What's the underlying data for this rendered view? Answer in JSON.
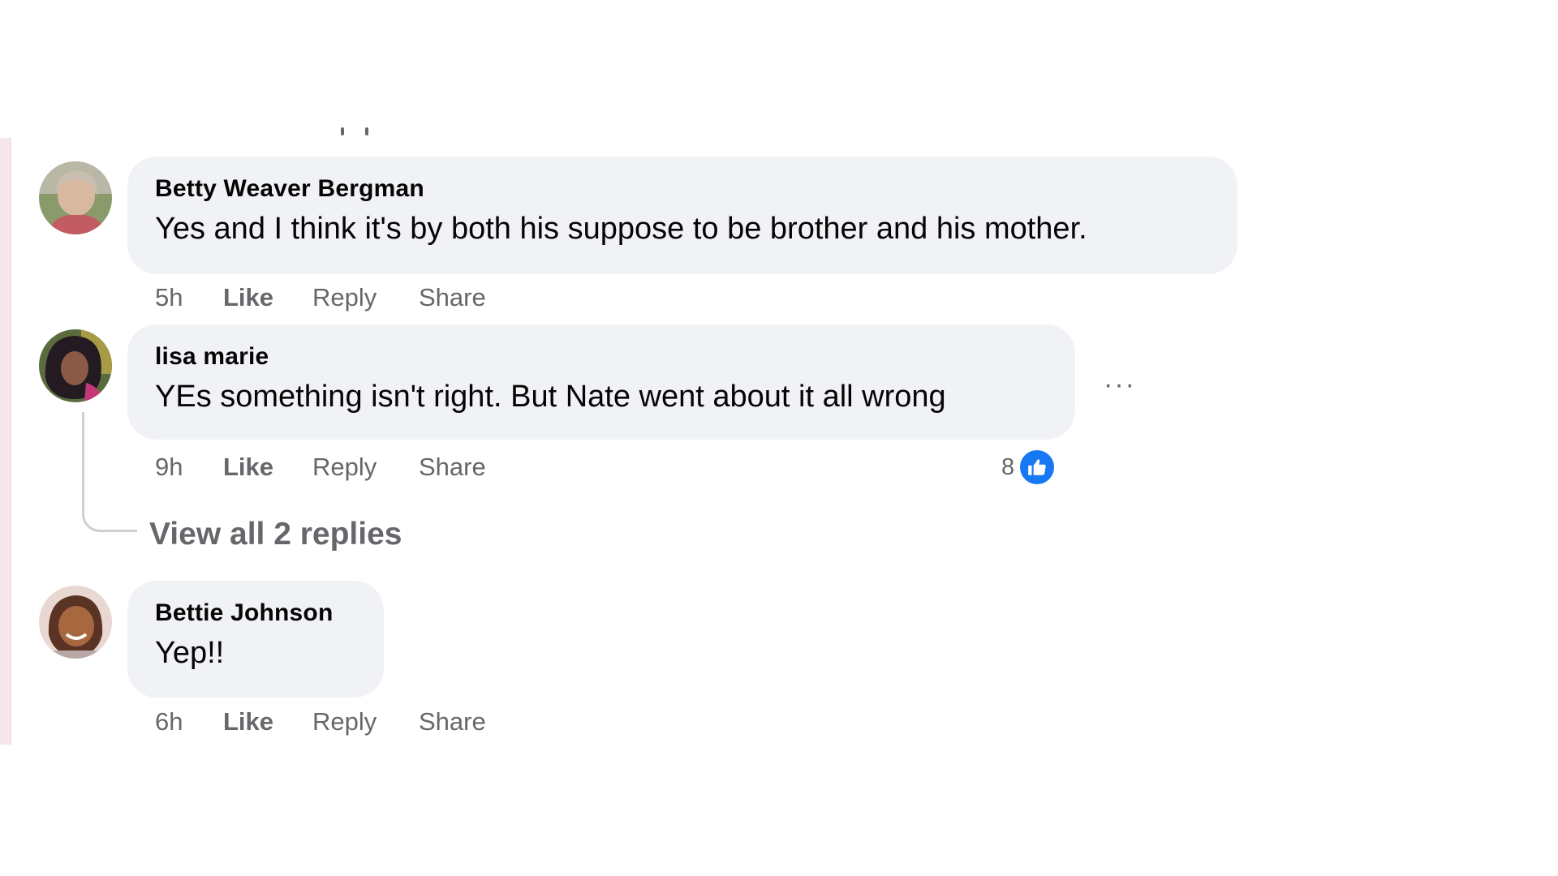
{
  "comments": [
    {
      "author": "Betty Weaver Bergman",
      "text": "Yes and I think it's by both his suppose to be brother and his mother.",
      "time": "5h",
      "like_label": "Like",
      "reply_label": "Reply",
      "share_label": "Share"
    },
    {
      "author": "lisa marie",
      "text": "YEs something isn't right. But Nate went about it all wrong",
      "time": "9h",
      "like_label": "Like",
      "reply_label": "Reply",
      "share_label": "Share",
      "reaction_count": "8",
      "reaction_icon": "thumbs-up-icon",
      "more_label": "···",
      "view_replies_label": "View all 2 replies"
    },
    {
      "author": "Bettie Johnson",
      "text": "Yep!!",
      "time": "6h",
      "like_label": "Like",
      "reply_label": "Reply",
      "share_label": "Share"
    }
  ],
  "colors": {
    "bubble": "#f0f2f5",
    "secondary_text": "#65676b",
    "like_blue": "#1877f2",
    "rail": "#f6e6e9"
  }
}
